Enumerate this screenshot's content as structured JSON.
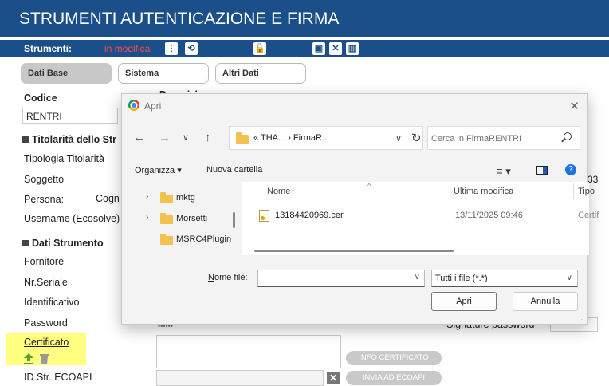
{
  "app": {
    "title": "STRUMENTI AUTENTICAZIONE E FIRMA",
    "toolbar_label": "Strumenti:",
    "mode": "in modifica",
    "tabs": [
      "Dati Base",
      "Sistema",
      "Altri Dati"
    ]
  },
  "form": {
    "codice_label": "Codice",
    "codice_value": "RENTRI",
    "desc_label": "Descrizi",
    "sec_titolarita": "Titolarità dello Str",
    "tipologia": "Tipologia Titolarità",
    "soggetto": "Soggetto",
    "persona": "Persona:",
    "cogn": "Cogn",
    "username": "Username (Ecosolve)",
    "sec_strumento": "Dati Strumento",
    "fornitore": "Fornitore",
    "nr_seriale": "Nr.Seriale",
    "identificativo": "Identificativo",
    "password": "Password",
    "password_mask": "••••••",
    "signature_password": "Signature password",
    "certificato": "Certificato",
    "id_str": "ID Str. ECOAPI",
    "info_cert_btn": "INFO CERTIFICATO",
    "invia_btn": "INVIA AD ECOAPI",
    "side_number": "33"
  },
  "dialog": {
    "title": "Apri",
    "breadcrumb": "«  THA...  ›  FirmaR...",
    "search_placeholder": "Cerca in FirmaRENTRI",
    "organize": "Organizza ▾",
    "new_folder": "Nuova cartella",
    "tree": [
      {
        "name": "mktg",
        "expandable": true
      },
      {
        "name": "Morsetti",
        "expandable": true
      },
      {
        "name": "MSRC4Plugin",
        "expandable": false
      }
    ],
    "columns": [
      "Nome",
      "Ultima modifica",
      "Tipo"
    ],
    "files": [
      {
        "name": "13184420969.cer",
        "modified": "13/11/2025 09:46",
        "type": "Certif"
      }
    ],
    "filename_label": "Nome file:",
    "filename_value": "",
    "filetype": "Tutti i file (*.*)",
    "open_btn": "Apri",
    "cancel_btn": "Annulla"
  },
  "colors": {
    "header_blue": "#1a4f8a",
    "mode_red": "#ff4a4a",
    "highlight": "#ffff80",
    "upload_green": "#5aa02c"
  }
}
